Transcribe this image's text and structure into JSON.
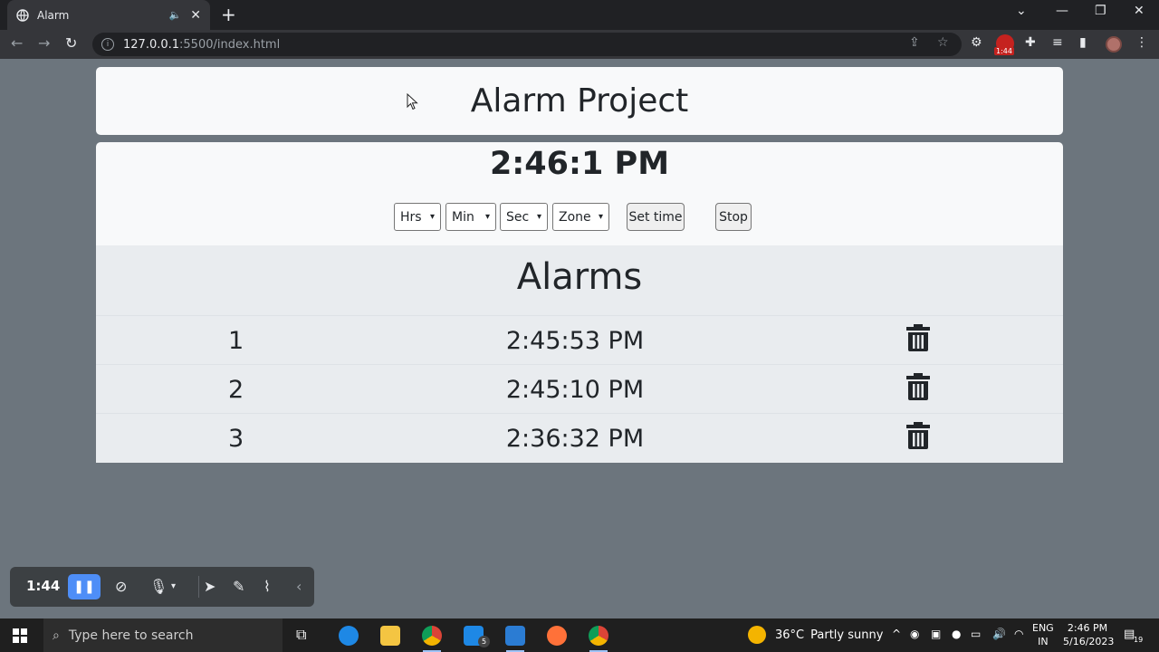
{
  "browser": {
    "tab_title": "Alarm",
    "new_tab": "+",
    "url_host": "127.0.0.1",
    "url_path": ":5500/index.html",
    "extension_badge": "1:44"
  },
  "page": {
    "header_title": "Alarm Project",
    "clock": "2:46:1 PM",
    "controls": {
      "hours": "Hrs",
      "minutes": "Min",
      "seconds": "Sec",
      "zone": "Zone",
      "set_time": "Set time",
      "stop": "Stop"
    },
    "alarms_title": "Alarms",
    "alarms": [
      {
        "index": "1",
        "time": "2:45:53 PM"
      },
      {
        "index": "2",
        "time": "2:45:10 PM"
      },
      {
        "index": "3",
        "time": "2:36:32 PM"
      }
    ]
  },
  "recorder": {
    "elapsed": "1:44"
  },
  "taskbar": {
    "search_placeholder": "Type here to search",
    "mail_badge": "5",
    "weather_temp": "36°C",
    "weather_desc": "Partly sunny",
    "lang_line1": "ENG",
    "lang_line2": "IN",
    "time": "2:46 PM",
    "date": "5/16/2023",
    "notifications": "19"
  },
  "colors": {
    "page_bg": "#6c757d",
    "card_bg": "#f8f9fa",
    "alarms_bg": "#e9ecef",
    "text": "#212529",
    "recorder_accent": "#4e8ef7"
  }
}
